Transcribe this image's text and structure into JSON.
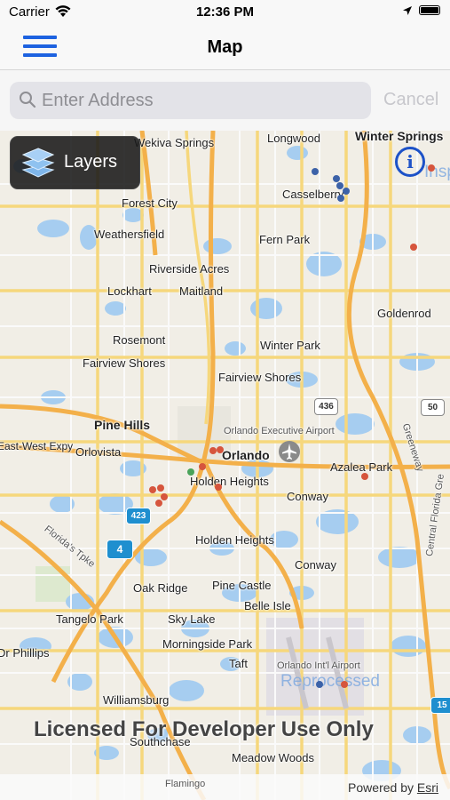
{
  "status": {
    "carrier": "Carrier",
    "time": "12:36 PM"
  },
  "nav": {
    "title": "Map"
  },
  "search": {
    "placeholder": "Enter Address",
    "cancel": "Cancel"
  },
  "layers": {
    "label": "Layers"
  },
  "info": {
    "label": "i"
  },
  "map_labels": {
    "wekiva_springs": "Wekiva Springs",
    "longwood": "Longwood",
    "winter_springs": "Winter Springs",
    "casselberry": "Casselberry",
    "forest_city": "Forest City",
    "weathersfield": "Weathersfield",
    "fern_park": "Fern Park",
    "riverside_acres": "Riverside Acres",
    "lockhart": "Lockhart",
    "maitland": "Maitland",
    "goldenrod": "Goldenrod",
    "rosemont": "Rosemont",
    "winter_park": "Winter Park",
    "fairview_shores_1": "Fairview Shores",
    "fairview_shores_2": "Fairview Shores",
    "pine_hills": "Pine Hills",
    "orlando_exec": "Orlando Executive Airport",
    "east_west": "East-West Expy",
    "orlovista": "Orlovista",
    "orlando": "Orlando",
    "azalea_park": "Azalea Park",
    "holden_heights_1": "Holden Heights",
    "conway_1": "Conway",
    "holden_heights_2": "Holden Heights",
    "conway_2": "Conway",
    "oak_ridge": "Oak Ridge",
    "pine_castle": "Pine Castle",
    "tangelo_park": "Tangelo Park",
    "sky_lake": "Sky Lake",
    "belle_isle": "Belle Isle",
    "dr_phillips": "Dr Phillips",
    "morningside_park": "Morningside Park",
    "taft": "Taft",
    "orlando_intl": "Orlando Int'l Airport",
    "williamsburg": "Williamsburg",
    "southchase": "Southchase",
    "meadow_woods": "Meadow Woods",
    "flamingo": "Flamingo",
    "floridas_tpke": "Florida's Tpke",
    "greeneway": "Greeneway",
    "central_florida_gre": "Central Florida Gre"
  },
  "shields": {
    "s436": "436",
    "s50": "50",
    "s423": "423",
    "s4": "4",
    "s15": "15"
  },
  "watermark": "Licensed For Developer Use Only",
  "faint_text": "Reprocessed",
  "faint_text_2": "Insp",
  "attribution": {
    "powered_by": "Powered by",
    "esri": "Esri"
  },
  "colors": {
    "accent": "#1d62e0",
    "incident_red": "#d6553d",
    "incident_blue": "#3c62a8"
  }
}
